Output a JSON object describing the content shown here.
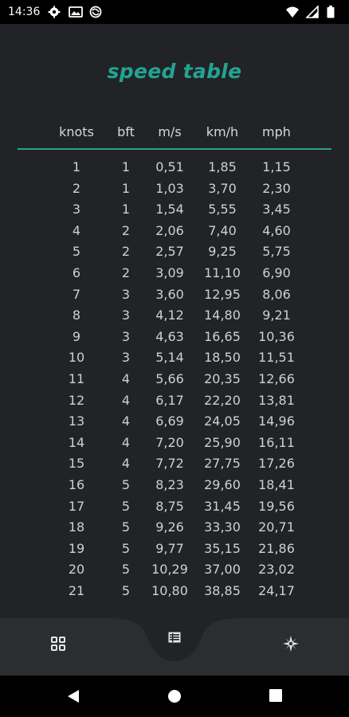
{
  "status": {
    "time": "14:36",
    "icons_left": [
      "gear-icon",
      "image-icon",
      "no-disturb-icon"
    ],
    "icons_right": [
      "wifi-icon",
      "signal-icon",
      "battery-icon"
    ]
  },
  "title": "speed table",
  "columns": [
    "knots",
    "bft",
    "m/s",
    "km/h",
    "mph"
  ],
  "rows": [
    [
      "1",
      "1",
      "0,51",
      "1,85",
      "1,15"
    ],
    [
      "2",
      "1",
      "1,03",
      "3,70",
      "2,30"
    ],
    [
      "3",
      "1",
      "1,54",
      "5,55",
      "3,45"
    ],
    [
      "4",
      "2",
      "2,06",
      "7,40",
      "4,60"
    ],
    [
      "5",
      "2",
      "2,57",
      "9,25",
      "5,75"
    ],
    [
      "6",
      "2",
      "3,09",
      "11,10",
      "6,90"
    ],
    [
      "7",
      "3",
      "3,60",
      "12,95",
      "8,06"
    ],
    [
      "8",
      "3",
      "4,12",
      "14,80",
      "9,21"
    ],
    [
      "9",
      "3",
      "4,63",
      "16,65",
      "10,36"
    ],
    [
      "10",
      "3",
      "5,14",
      "18,50",
      "11,51"
    ],
    [
      "11",
      "4",
      "5,66",
      "20,35",
      "12,66"
    ],
    [
      "12",
      "4",
      "6,17",
      "22,20",
      "13,81"
    ],
    [
      "13",
      "4",
      "6,69",
      "24,05",
      "14,96"
    ],
    [
      "14",
      "4",
      "7,20",
      "25,90",
      "16,11"
    ],
    [
      "15",
      "4",
      "7,72",
      "27,75",
      "17,26"
    ],
    [
      "16",
      "5",
      "8,23",
      "29,60",
      "18,41"
    ],
    [
      "17",
      "5",
      "8,75",
      "31,45",
      "19,56"
    ],
    [
      "18",
      "5",
      "9,26",
      "33,30",
      "20,71"
    ],
    [
      "19",
      "5",
      "9,77",
      "35,15",
      "21,86"
    ],
    [
      "20",
      "5",
      "10,29",
      "37,00",
      "23,02"
    ],
    [
      "21",
      "5",
      "10,80",
      "38,85",
      "24,17"
    ]
  ],
  "bottom_nav": {
    "items": [
      "grid-icon",
      "table-icon",
      "compass-icon"
    ],
    "selected": "table-icon"
  },
  "colors": {
    "accent": "#22a492",
    "background": "#222326",
    "nav_background": "#2c2d30",
    "text": "#d2d3d6"
  },
  "system_nav": [
    "back-icon",
    "home-icon",
    "recents-icon"
  ]
}
